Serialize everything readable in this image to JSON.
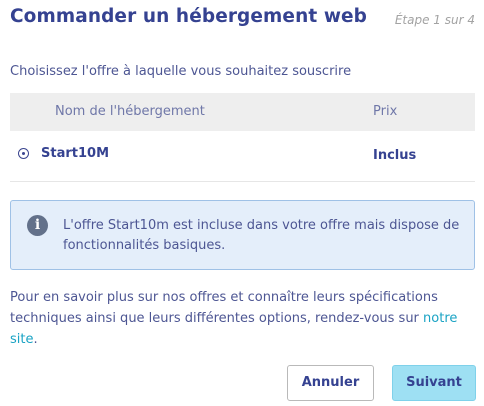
{
  "header": {
    "title": "Commander un hébergement web",
    "step": "Étape 1 sur 4"
  },
  "offer_section": {
    "instruction": "Choisissez l'offre à laquelle vous souhaitez souscrire",
    "columns": {
      "name": "Nom de l'hébergement",
      "price": "Prix"
    },
    "rows": [
      {
        "name": "Start10M",
        "price": "Inclus",
        "selected": true
      }
    ]
  },
  "info_box": {
    "icon": "info-icon",
    "text": "L'offre Start10m est incluse dans votre offre mais dispose de fonctionnalités basiques."
  },
  "more_info": {
    "text_before": "Pour en savoir plus sur nos offres et connaître leurs spécifications techniques ainsi que leurs différentes options, rendez-vous sur ",
    "link_text": "notre site",
    "text_after": "."
  },
  "buttons": {
    "cancel": "Annuler",
    "next": "Suivant"
  },
  "colors": {
    "title": "#354291",
    "text": "#4d5693",
    "link": "#1aa3c4",
    "info_bg": "#e4eefa",
    "info_border": "#9fc1e6",
    "primary_button": "#9ee0f3"
  }
}
